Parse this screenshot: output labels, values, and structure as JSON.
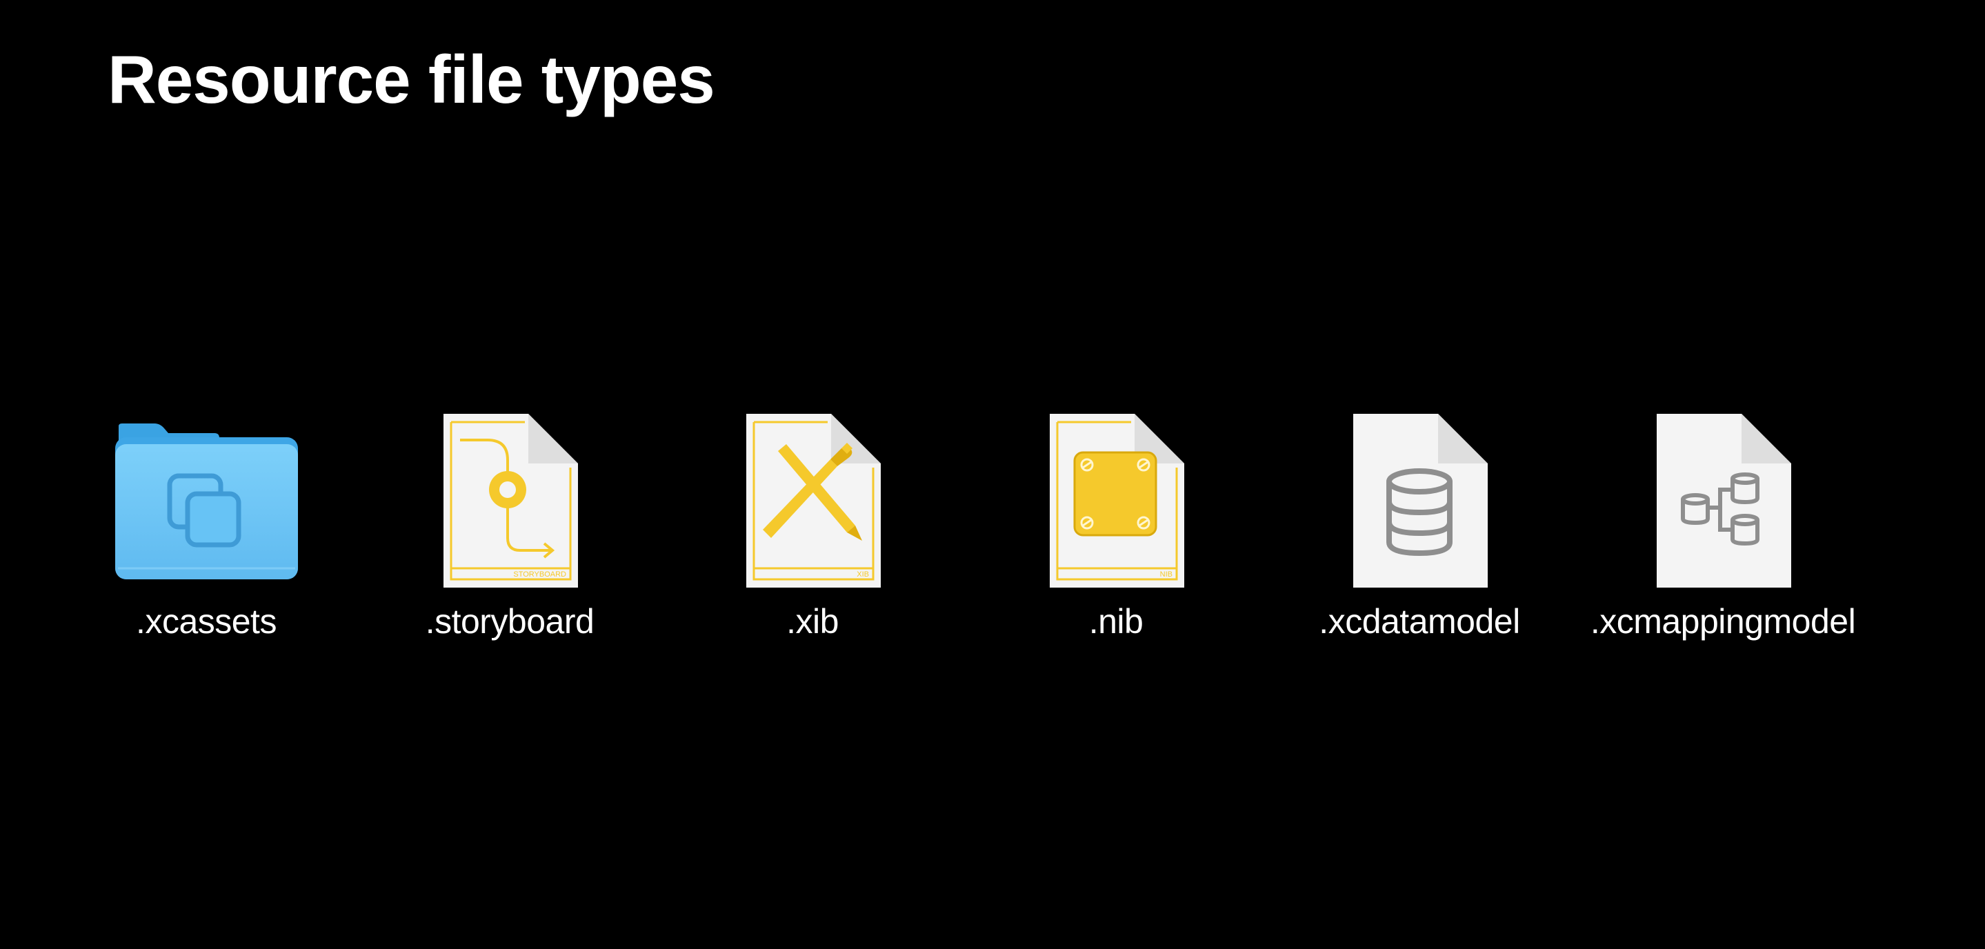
{
  "slide": {
    "title": "Resource file types"
  },
  "items": [
    {
      "label": ".xcassets",
      "icon": "asset-catalog-folder-icon",
      "fine_print": ""
    },
    {
      "label": ".storyboard",
      "icon": "storyboard-file-icon",
      "fine_print": "STORYBOARD"
    },
    {
      "label": ".xib",
      "icon": "xib-file-icon",
      "fine_print": "XIB"
    },
    {
      "label": ".nib",
      "icon": "nib-file-icon",
      "fine_print": "NIB"
    },
    {
      "label": ".xcdatamodel",
      "icon": "data-model-file-icon",
      "fine_print": ""
    },
    {
      "label": ".xcmappingmodel",
      "icon": "mapping-model-file-icon",
      "fine_print": ""
    }
  ],
  "colors": {
    "background": "#000000",
    "text": "#ffffff",
    "folder_blue": "#67c3f5",
    "accent_yellow": "#f5c92c",
    "page": "#f4f4f4",
    "gray_glyph": "#8e8e8e"
  }
}
